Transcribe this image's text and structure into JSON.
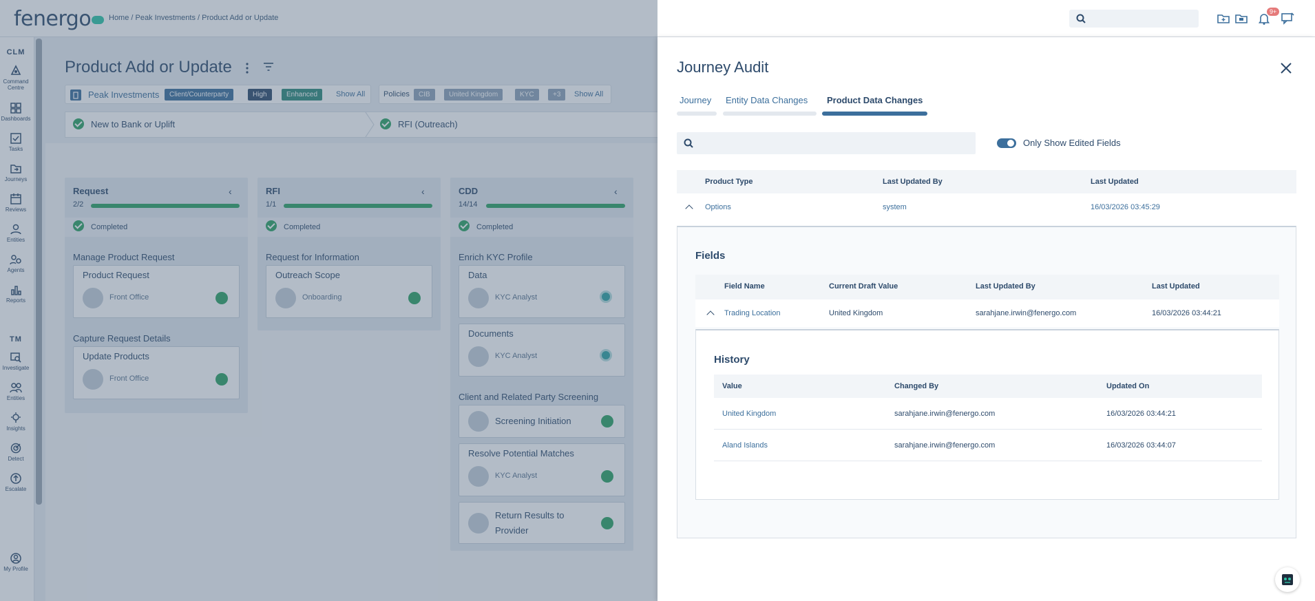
{
  "header": {
    "logo": "fenergo",
    "breadcrumb": "Home / Peak Investments / Product Add or Update",
    "notification_count": "9+"
  },
  "rail": {
    "section_clm": "CLM",
    "section_tm": "TM",
    "clm_items": [
      {
        "label": "Command Centre",
        "icon": "command-centre-icon"
      },
      {
        "label": "Dashboards",
        "icon": "dashboards-icon"
      },
      {
        "label": "Tasks",
        "icon": "tasks-icon"
      },
      {
        "label": "Journeys",
        "icon": "journeys-icon"
      },
      {
        "label": "Reviews",
        "icon": "reviews-icon"
      },
      {
        "label": "Entities",
        "icon": "entities-icon"
      },
      {
        "label": "Agents",
        "icon": "agents-icon"
      },
      {
        "label": "Reports",
        "icon": "reports-icon"
      }
    ],
    "tm_items": [
      {
        "label": "Investigate",
        "icon": "investigate-icon"
      },
      {
        "label": "Entities",
        "icon": "entities-icon"
      },
      {
        "label": "Insights",
        "icon": "insights-icon"
      },
      {
        "label": "Detect",
        "icon": "detect-icon"
      },
      {
        "label": "Escalate",
        "icon": "escalate-icon"
      }
    ],
    "profile": "My Profile"
  },
  "main": {
    "title": "Product Add or Update",
    "entity": {
      "name": "Peak Investments",
      "chips": [
        "Client/Counterparty",
        "High",
        "Enhanced"
      ],
      "show_all": "Show All"
    },
    "policies": {
      "label": "Policies",
      "chips": [
        "CIB",
        "United Kingdom",
        "KYC",
        "+3"
      ],
      "show_all": "Show All"
    },
    "stages": [
      "New to Bank or Uplift",
      "RFI (Outreach)"
    ],
    "columns": [
      {
        "title": "Request",
        "count": "2/2",
        "status": "Completed",
        "groups": [
          {
            "title": "Manage Product Request",
            "tasks": [
              {
                "title": "Product Request",
                "role": "Front Office"
              }
            ]
          },
          {
            "title": "Capture Request Details",
            "tasks": [
              {
                "title": "Update Products",
                "role": "Front Office"
              }
            ]
          }
        ]
      },
      {
        "title": "RFI",
        "count": "1/1",
        "status": "Completed",
        "groups": [
          {
            "title": "Request for Information",
            "tasks": [
              {
                "title": "Outreach Scope",
                "role": "Onboarding"
              }
            ]
          }
        ]
      },
      {
        "title": "CDD",
        "count": "14/14",
        "status": "Completed",
        "groups": [
          {
            "title": "Enrich KYC Profile",
            "tasks": [
              {
                "title": "Data",
                "role": "KYC Analyst"
              },
              {
                "title": "Documents",
                "role": "KYC Analyst"
              }
            ]
          },
          {
            "title": "Client and Related Party Screening",
            "tasks": [
              {
                "title": "Screening Initiation",
                "role": ""
              },
              {
                "title": "Resolve Potential Matches",
                "role": "KYC Analyst"
              },
              {
                "title": "Return Results to Provider",
                "role": ""
              }
            ]
          }
        ]
      }
    ]
  },
  "panel": {
    "title": "Journey Audit",
    "tabs": [
      "Journey",
      "Entity Data Changes",
      "Product Data Changes"
    ],
    "active_tab": "Product Data Changes",
    "search_placeholder": "",
    "toggle_label": "Only Show Edited Fields",
    "product_table": {
      "headers": [
        "Product Type",
        "Last Updated By",
        "Last Updated"
      ],
      "rows": [
        {
          "product_type": "Options",
          "last_updated_by": "system",
          "last_updated": "16/03/2026 03:45:29"
        }
      ]
    },
    "fields": {
      "title": "Fields",
      "headers": [
        "Field Name",
        "Current Draft Value",
        "Last Updated By",
        "Last Updated"
      ],
      "rows": [
        {
          "field_name": "Trading Location",
          "current_value": "United Kingdom",
          "last_updated_by": "sarahjane.irwin@fenergo.com",
          "last_updated": "16/03/2026 03:44:21"
        }
      ]
    },
    "history": {
      "title": "History",
      "headers": [
        "Value",
        "Changed By",
        "Updated On"
      ],
      "rows": [
        {
          "value": "United Kingdom",
          "changed_by": "sarahjane.irwin@fenergo.com",
          "updated_on": "16/03/2026 03:44:21"
        },
        {
          "value": "Aland Islands",
          "changed_by": "sarahjane.irwin@fenergo.com",
          "updated_on": "16/03/2026 03:44:07"
        }
      ]
    }
  },
  "colors": {
    "primary": "#2d4a6b",
    "accent": "#3c6f9c",
    "success": "#2ea365"
  }
}
